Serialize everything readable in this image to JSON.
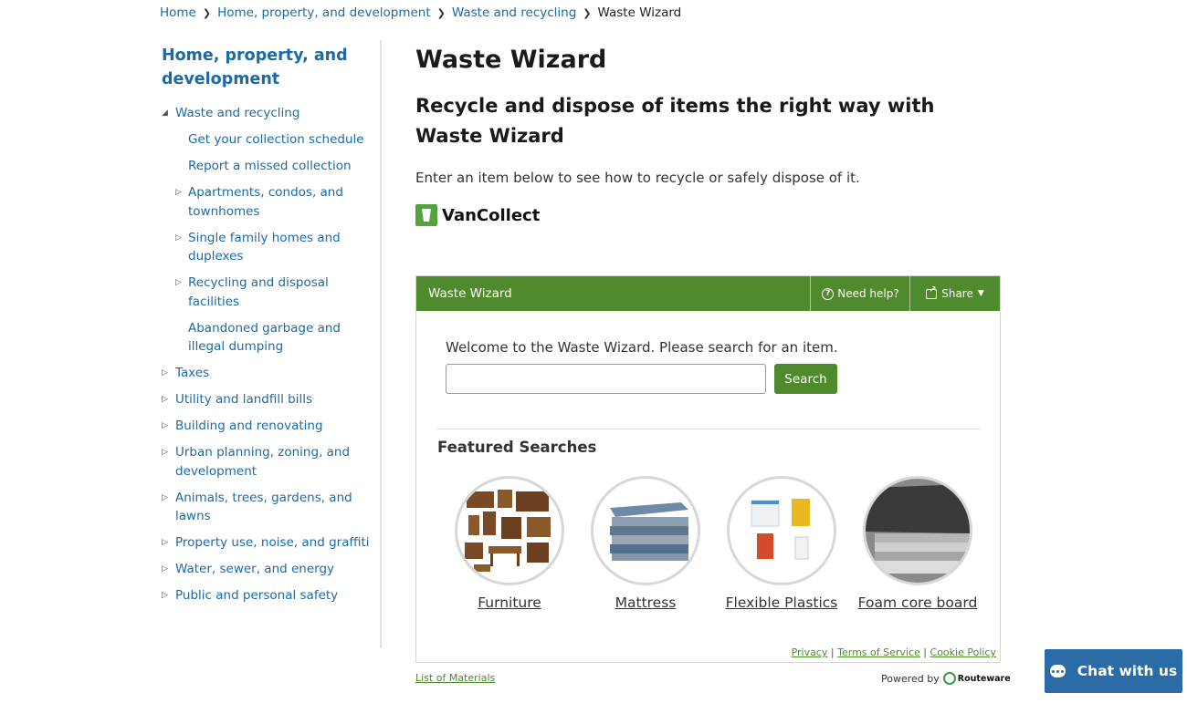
{
  "breadcrumb": [
    {
      "label": "Home"
    },
    {
      "label": "Home, property, and development"
    },
    {
      "label": "Waste and recycling"
    },
    {
      "label": "Waste Wizard",
      "current": true
    }
  ],
  "sidebar": {
    "title": "Home, property, and development",
    "items": [
      {
        "label": "Waste and recycling",
        "expanded": true
      },
      {
        "label": "Get your collection schedule",
        "sub": true
      },
      {
        "label": "Report a missed collection",
        "sub": true
      },
      {
        "label": "Apartments, condos, and townhomes",
        "sub": true,
        "collapsible": true
      },
      {
        "label": "Single family homes and duplexes",
        "sub": true,
        "collapsible": true
      },
      {
        "label": "Recycling and disposal facilities",
        "sub": true,
        "collapsible": true
      },
      {
        "label": "Abandoned garbage and illegal dumping",
        "sub": true
      },
      {
        "label": "Taxes",
        "collapsible": true
      },
      {
        "label": "Utility and landfill bills",
        "collapsible": true
      },
      {
        "label": "Building and renovating",
        "collapsible": true
      },
      {
        "label": "Urban planning, zoning, and development",
        "collapsible": true
      },
      {
        "label": "Animals, trees, gardens, and lawns",
        "collapsible": true
      },
      {
        "label": "Property use, noise, and graffiti",
        "collapsible": true
      },
      {
        "label": "Water, sewer, and energy",
        "collapsible": true
      },
      {
        "label": "Public and personal safety",
        "collapsible": true
      }
    ]
  },
  "main": {
    "title": "Waste Wizard",
    "subtitle": "Recycle and dispose of items the right way with Waste Wizard",
    "intro": "Enter an item below to see how to recycle or safely dispose of it.",
    "brand": "VanCollect"
  },
  "widget": {
    "header_title": "Waste Wizard",
    "help_label": "Need help?",
    "share_label": "Share",
    "welcome": "Welcome to the Waste Wizard. Please search for an item.",
    "search_value": "",
    "search_button": "Search",
    "featured_title": "Featured Searches",
    "featured": [
      {
        "label": "Furniture"
      },
      {
        "label": "Mattress"
      },
      {
        "label": "Flexible Plastics"
      },
      {
        "label": "Foam core board"
      }
    ],
    "footer_links": [
      "Privacy",
      "Terms of Service",
      "Cookie Policy"
    ],
    "footer_sep": "|"
  },
  "below": {
    "list_link": "List of Materials",
    "powered_by": "Powered by",
    "powered_brand": "Routeware"
  },
  "chat": {
    "label": "Chat with us"
  },
  "colors": {
    "link": "#1b6aa8",
    "header_green": "#4f8a2c",
    "chat_blue": "#2b6ca6"
  }
}
